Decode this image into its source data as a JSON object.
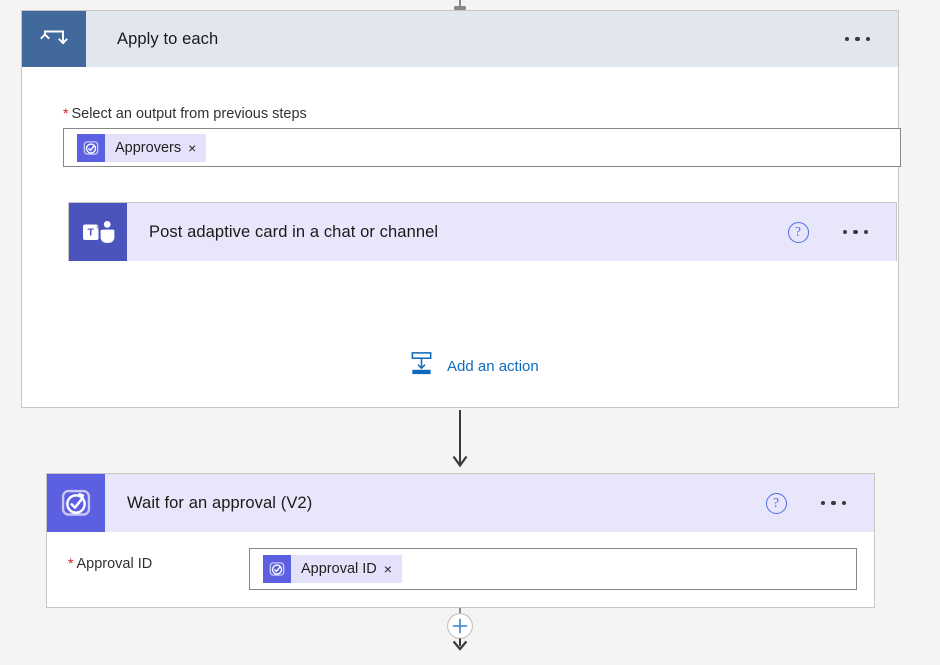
{
  "flow": {
    "scope": {
      "title": "Apply to each",
      "icon": "loop-repeat-icon",
      "menu_icon": "ellipsis-menu-icon",
      "header_color": "#e2e6ef",
      "icon_color": "#41699c",
      "field": {
        "label": "Select an output from previous steps",
        "required_marker": "*",
        "token": {
          "text": "Approvers",
          "remove": "×",
          "icon": "approvals-icon"
        }
      },
      "add_action": {
        "label": "Add an action",
        "icon": "insert-action-icon",
        "color": "#0f6cbd"
      }
    },
    "teams_action": {
      "title": "Post adaptive card in a chat or channel",
      "icon": "microsoft-teams-icon",
      "help_icon": "question-mark-icon",
      "help_glyph": "?",
      "menu_icon": "ellipsis-menu-icon",
      "icon_color": "#4b53bc",
      "header_color": "#e7e6fa"
    },
    "connector_arrow": {
      "icon": "down-arrow-icon"
    },
    "approval_action": {
      "title": "Wait for an approval (V2)",
      "icon": "approvals-icon",
      "help_icon": "question-mark-icon",
      "help_glyph": "?",
      "menu_icon": "ellipsis-menu-icon",
      "icon_color": "#5b5fe0",
      "header_color": "#e7e6fa",
      "field": {
        "label": "Approval ID",
        "required_marker": "*",
        "token": {
          "text": "Approval ID",
          "remove": "×",
          "icon": "approvals-icon"
        }
      }
    },
    "insert_step": {
      "icon": "plus-circle-icon",
      "color": "#0f6cbd"
    }
  }
}
